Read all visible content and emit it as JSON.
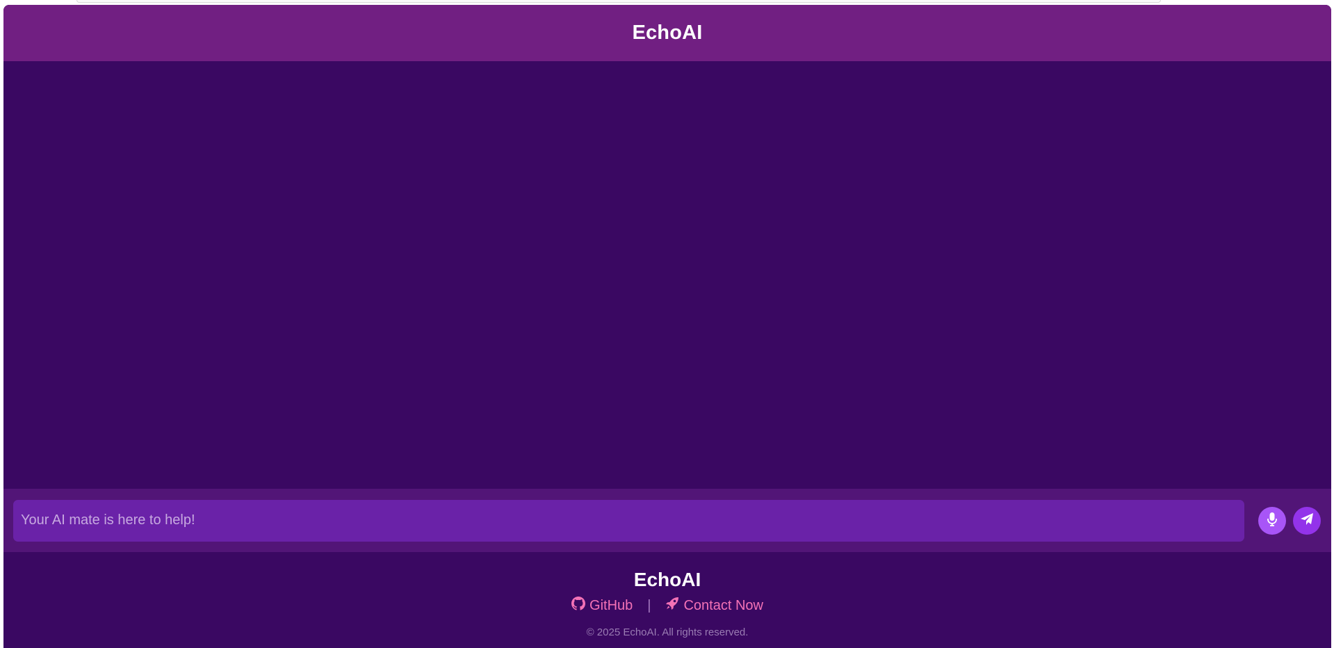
{
  "header": {
    "title": "EchoAI"
  },
  "composer": {
    "placeholder": "Your AI mate is here to help!",
    "mic_icon": "microphone-icon",
    "send_icon": "paper-plane-icon"
  },
  "footer": {
    "title": "EchoAI",
    "links": [
      {
        "label": "GitHub",
        "icon": "github-icon"
      },
      {
        "label": "Contact Now",
        "icon": "rocket-icon"
      }
    ],
    "separator": "|",
    "copyright": "© 2025 EchoAI. All rights reserved."
  },
  "colors": {
    "header_bg": "#711f82",
    "chat_bg": "#3a0862",
    "input_bar_bg": "#521577",
    "input_bg": "#6a22a8",
    "link": "#f472b6",
    "mic_button": "#a855f7",
    "send_button": "#9333ea"
  }
}
